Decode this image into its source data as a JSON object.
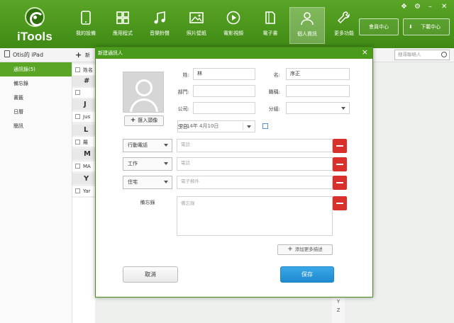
{
  "app": {
    "logo_text": "iTools"
  },
  "nav": {
    "items": [
      {
        "label": "我的設備",
        "icon": "device-icon"
      },
      {
        "label": "應用程式",
        "icon": "apps-icon"
      },
      {
        "label": "音樂鈴聲",
        "icon": "music-icon"
      },
      {
        "label": "照片壁紙",
        "icon": "photo-icon"
      },
      {
        "label": "電影視頻",
        "icon": "video-icon"
      },
      {
        "label": "電子書",
        "icon": "book-icon"
      },
      {
        "label": "個人資訊",
        "icon": "person-icon",
        "active": true
      },
      {
        "label": "更多功能",
        "icon": "tools-icon"
      }
    ]
  },
  "top_buttons": {
    "member": "會員中心",
    "download": "下載中心"
  },
  "window_controls": {
    "minimize": "–",
    "close": "✕"
  },
  "sidebar": {
    "device": "Otis的 iPad",
    "items": [
      {
        "label": "通訊錄(5)",
        "active": true
      },
      {
        "label": "備忘錄"
      },
      {
        "label": "書籤"
      },
      {
        "label": "日曆"
      },
      {
        "label": "簡訊"
      }
    ]
  },
  "list": {
    "new_label": "新",
    "search_placeholder": "搜尋聯絡人",
    "header": "姓名",
    "letters": [
      "#",
      "J",
      "L",
      "M",
      "Y"
    ],
    "rows": [
      "Jus",
      "羅",
      "MA",
      "Yar"
    ],
    "index_tail": [
      "Y",
      "Z"
    ]
  },
  "dialog": {
    "title": "新建通訊人",
    "close": "×",
    "avatar_button": "匯入頭像",
    "labels": {
      "last_name": "姓:",
      "first_name": "名:",
      "department": "部門:",
      "position": "職稱:",
      "company": "公司:",
      "group": "分組:",
      "birthday": "生日:"
    },
    "values": {
      "last_name": "林",
      "first_name": "序正",
      "birthday": "2014年 4月10日"
    },
    "rows": [
      {
        "type": "行動電話",
        "placeholder": "電話"
      },
      {
        "type": "工作",
        "placeholder": "電話"
      },
      {
        "type": "住宅",
        "placeholder": "電子郵件"
      }
    ],
    "note_label": "備忘錄",
    "note_placeholder": "備忘錄",
    "add_more": "添加更多描述",
    "cancel": "取消",
    "save": "保存"
  }
}
